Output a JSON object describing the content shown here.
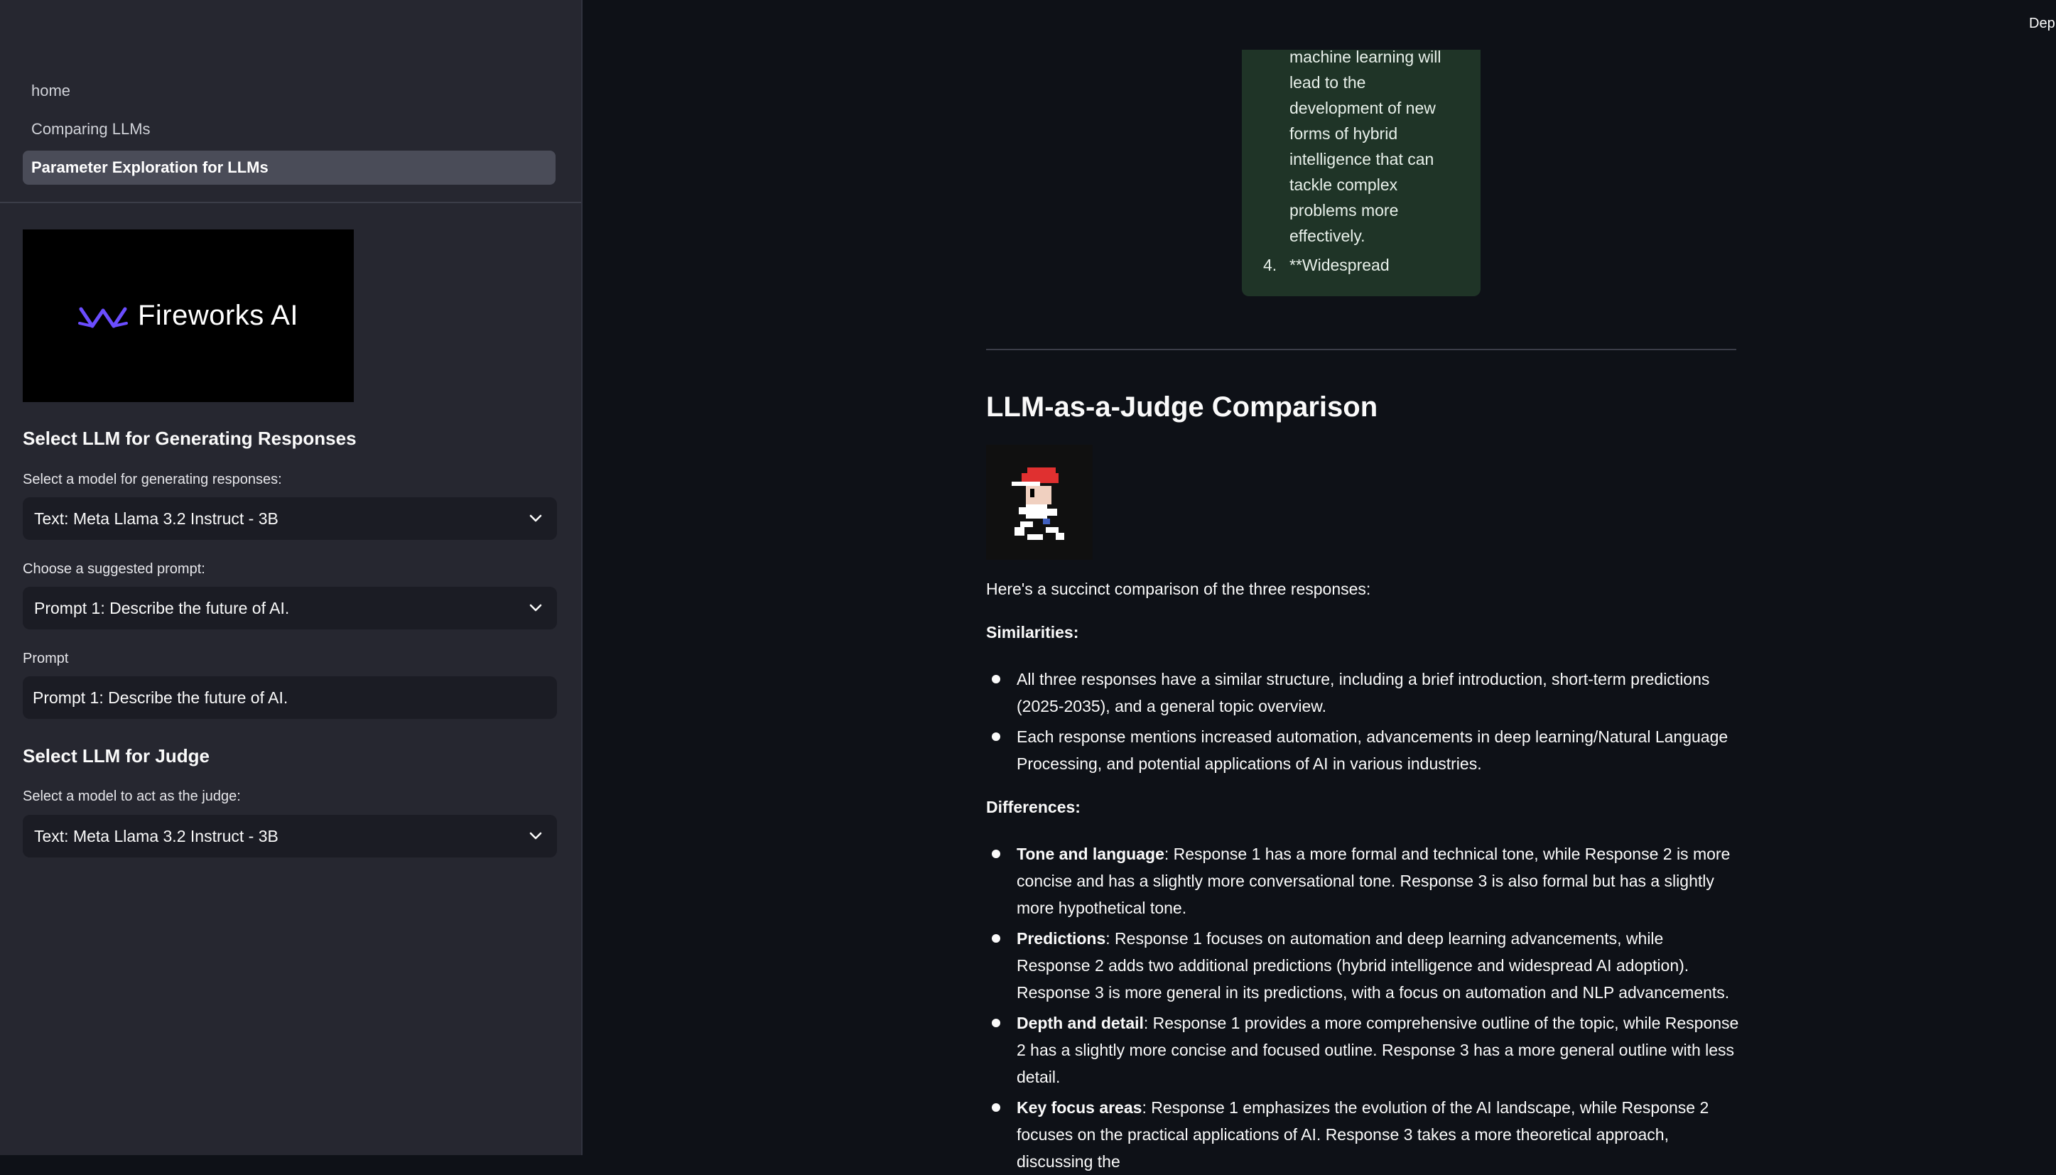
{
  "sidebar": {
    "nav": [
      {
        "label": "home"
      },
      {
        "label": "Comparing LLMs"
      },
      {
        "label": "Parameter Exploration for LLMs"
      }
    ],
    "logo_text": "Fireworks AI",
    "gen_heading": "Select LLM for Generating Responses",
    "gen_model_label": "Select a model for generating responses:",
    "gen_model_value": "Text: Meta Llama 3.2 Instruct - 3B",
    "prompt_choice_label": "Choose a suggested prompt:",
    "prompt_choice_value": "Prompt 1: Describe the future of AI.",
    "prompt_label": "Prompt",
    "prompt_value": "Prompt 1: Describe the future of AI.",
    "judge_heading": "Select LLM for Judge",
    "judge_model_label": "Select a model to act as the judge:",
    "judge_model_value": "Text: Meta Llama 3.2 Instruct - 3B"
  },
  "header": {
    "deploy_label": "Deploy"
  },
  "card": {
    "lines": [
      "machine learning will",
      "lead to the",
      "development of new",
      "forms of hybrid",
      "intelligence that can",
      "tackle complex",
      "problems more",
      "effectively."
    ],
    "item_num": "4.",
    "item_text": "**Widespread"
  },
  "main": {
    "title": "LLM-as-a-Judge Comparison",
    "intro": "Here's a succinct comparison of the three responses:",
    "similarities_heading": "Similarities:",
    "similarities": [
      "All three responses have a similar structure, including a brief introduction, short-term predictions (2025-2035), and a general topic overview.",
      "Each response mentions increased automation, advancements in deep learning/Natural Language Processing, and potential applications of AI in various industries."
    ],
    "differences_heading": "Differences:",
    "differences": [
      {
        "term": "Tone and language",
        "text": ": Response 1 has a more formal and technical tone, while Response 2 is more concise and has a slightly more conversational tone. Response 3 is also formal but has a slightly more hypothetical tone."
      },
      {
        "term": "Predictions",
        "text": ": Response 1 focuses on automation and deep learning advancements, while Response 2 adds two additional predictions (hybrid intelligence and widespread AI adoption). Response 3 is more general in its predictions, with a focus on automation and NLP advancements."
      },
      {
        "term": "Depth and detail",
        "text": ": Response 1 provides a more comprehensive outline of the topic, while Response 2 has a slightly more concise and focused outline. Response 3 has a more general outline with less detail."
      },
      {
        "term": "Key focus areas",
        "text": ": Response 1 emphasizes the evolution of the AI landscape, while Response 2 focuses on the practical applications of AI. Response 3 takes a more theoretical approach, discussing the"
      }
    ]
  },
  "colors": {
    "accent_logo": "#6b4dff",
    "card_bg": "#1f3427"
  }
}
